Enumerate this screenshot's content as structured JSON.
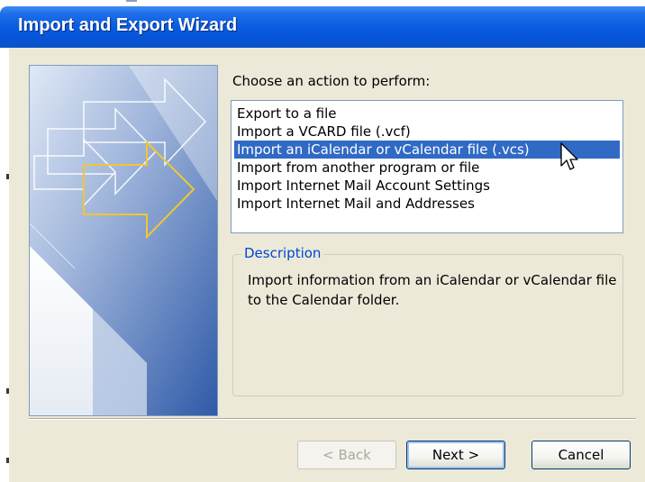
{
  "window": {
    "title": "Import and Export Wizard"
  },
  "main": {
    "prompt": "Choose an action to perform:",
    "actions": [
      {
        "label": "Export to a file",
        "selected": false
      },
      {
        "label": "Import a VCARD file (.vcf)",
        "selected": false
      },
      {
        "label": "Import an iCalendar or vCalendar file (.vcs)",
        "selected": true
      },
      {
        "label": "Import from another program or file",
        "selected": false
      },
      {
        "label": "Import Internet Mail Account Settings",
        "selected": false
      },
      {
        "label": "Import Internet Mail and Addresses",
        "selected": false
      }
    ],
    "description": {
      "label": "Description",
      "text": "Import information from an iCalendar or vCalendar file to the Calendar folder."
    }
  },
  "buttons": {
    "back": "< Back",
    "next": "Next >",
    "cancel": "Cancel"
  },
  "colors": {
    "title_bar": "#0a5ce0",
    "selection": "#316ac5",
    "group_label": "#0046d5",
    "dialog_face": "#ece9d8"
  }
}
